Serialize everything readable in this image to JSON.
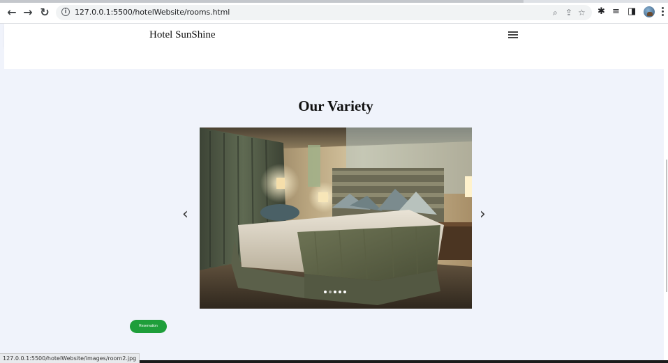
{
  "browser": {
    "url": "127.0.0.1:5500/hotelWebsite/rooms.html",
    "status_url": "127.0.0.1:5500/hotelWebsite/images/room2.jpg"
  },
  "site": {
    "brand": "Hotel SunShine"
  },
  "main": {
    "section_title": "Our Variety",
    "carousel": {
      "prev_glyph": "‹",
      "next_glyph": "›",
      "slide_count": 5,
      "active_index": 1
    },
    "reservation_label": "Reservation"
  },
  "colors": {
    "page_bg": "#f0f3fb",
    "reservation": "#1e9e3a"
  }
}
